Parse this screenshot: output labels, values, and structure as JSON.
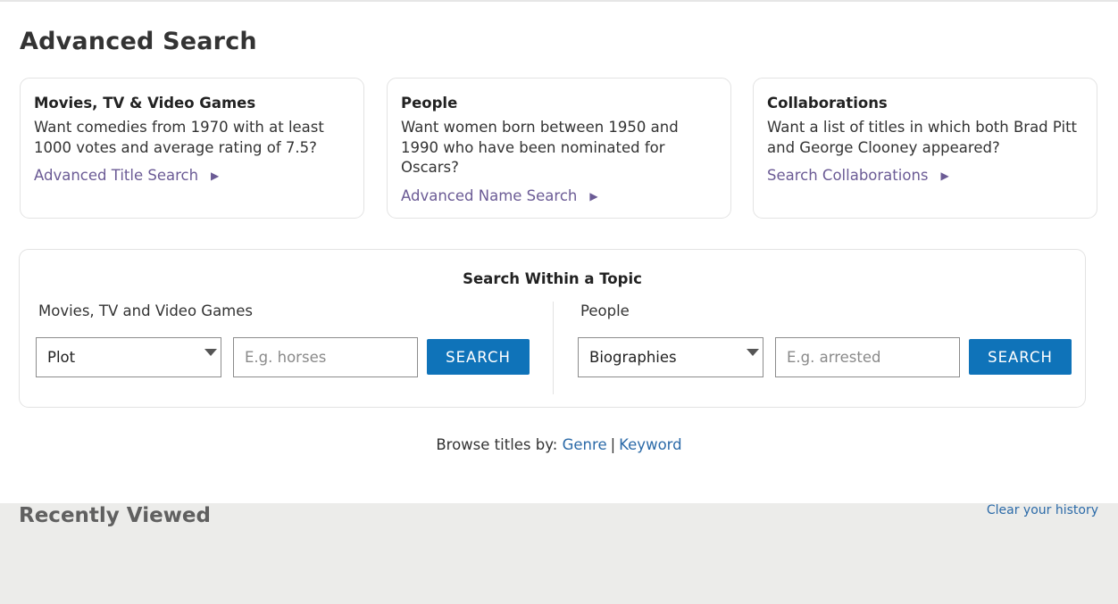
{
  "page": {
    "title": "Advanced Search"
  },
  "cards": [
    {
      "heading": "Movies, TV & Video Games",
      "description": "Want comedies from 1970 with at least 1000 votes and average rating of 7.5?",
      "link": "Advanced Title Search",
      "arrow": "▶"
    },
    {
      "heading": "People",
      "description": "Want women born between 1950 and 1990 who have been nominated for Oscars?",
      "link": "Advanced Name Search",
      "arrow": "▶"
    },
    {
      "heading": "Collaborations",
      "description": "Want a list of titles in which both Brad Pitt and George Clooney appeared?",
      "link": "Search Collaborations",
      "arrow": "▶"
    }
  ],
  "topic": {
    "title": "Search Within a Topic",
    "left": {
      "label": "Movies, TV and Video Games",
      "select_value": "Plot",
      "input_placeholder": "E.g. horses",
      "button": "SEARCH"
    },
    "right": {
      "label": "People",
      "select_value": "Biographies",
      "input_placeholder": "E.g. arrested",
      "button": "SEARCH"
    }
  },
  "browse": {
    "prefix": "Browse titles by:",
    "genre": "Genre",
    "separator": "|",
    "keyword": "Keyword"
  },
  "recent": {
    "title": "Recently Viewed",
    "clear": "Clear your history"
  },
  "colors": {
    "accent_link": "#6b5b95",
    "button_blue": "#0f73b9",
    "link_blue": "#2b6aa8",
    "recent_bg": "#ececea"
  }
}
